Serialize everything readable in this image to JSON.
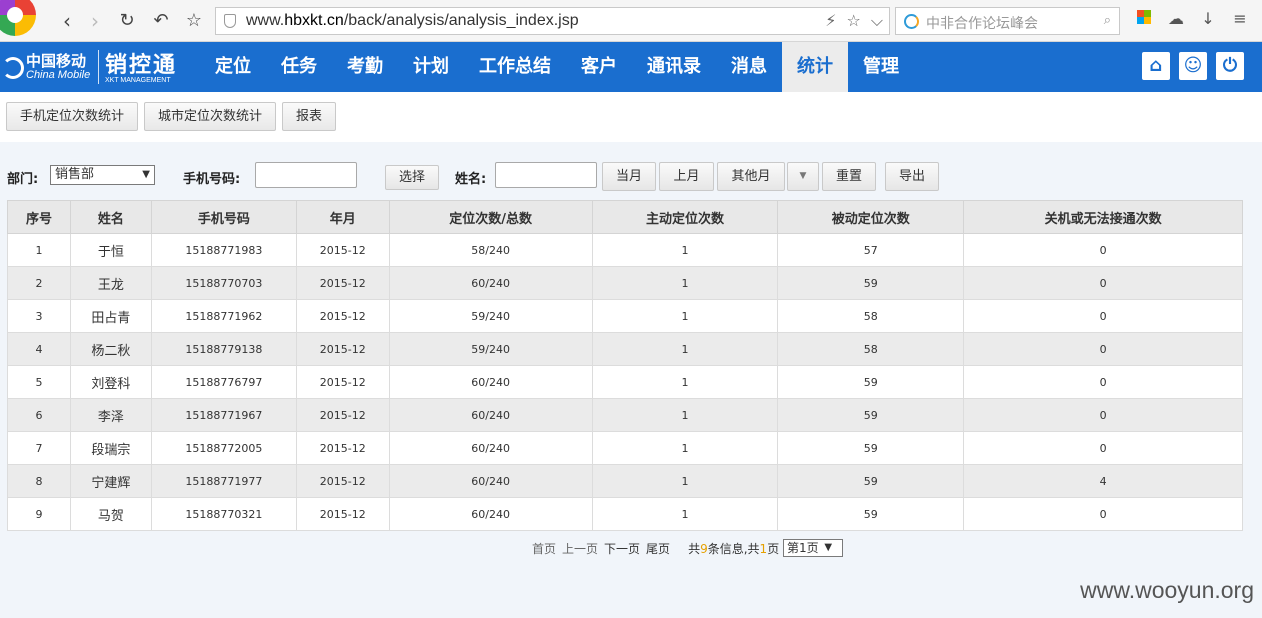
{
  "browser": {
    "url_prefix": "www.",
    "url_host": "hbxkt.cn",
    "url_path": "/back/analysis/analysis_index.jsp",
    "search_placeholder": "中非合作论坛峰会"
  },
  "brand": {
    "carrier_cn": "中国移动",
    "carrier_en": "China Mobile",
    "product_name": "销控通",
    "product_sub": "XKT MANAGEMENT"
  },
  "menu": {
    "items": [
      {
        "label": "定位"
      },
      {
        "label": "任务"
      },
      {
        "label": "考勤"
      },
      {
        "label": "计划"
      },
      {
        "label": "工作总结"
      },
      {
        "label": "客户"
      },
      {
        "label": "通讯录"
      },
      {
        "label": "消息"
      },
      {
        "label": "统计",
        "active": true
      },
      {
        "label": "管理"
      }
    ]
  },
  "subtabs": [
    {
      "label": "手机定位次数统计"
    },
    {
      "label": "城市定位次数统计"
    },
    {
      "label": "报表"
    }
  ],
  "filters": {
    "dept_label": "部门:",
    "dept_value": "销售部",
    "phone_label": "手机号码:",
    "select_button": "选择",
    "name_label": "姓名:",
    "this_month": "当月",
    "last_month": "上月",
    "other_month": "其他月",
    "reset": "重置",
    "export": "导出"
  },
  "table": {
    "columns": [
      "序号",
      "姓名",
      "手机号码",
      "年月",
      "定位次数/总数",
      "主动定位次数",
      "被动定位次数",
      "关机或无法接通次数"
    ],
    "rows": [
      [
        "1",
        "于恒",
        "15188771983",
        "2015-12",
        "58/240",
        "1",
        "57",
        "0"
      ],
      [
        "2",
        "王龙",
        "15188770703",
        "2015-12",
        "60/240",
        "1",
        "59",
        "0"
      ],
      [
        "3",
        "田占青",
        "15188771962",
        "2015-12",
        "59/240",
        "1",
        "58",
        "0"
      ],
      [
        "4",
        "杨二秋",
        "15188779138",
        "2015-12",
        "59/240",
        "1",
        "58",
        "0"
      ],
      [
        "5",
        "刘登科",
        "15188776797",
        "2015-12",
        "60/240",
        "1",
        "59",
        "0"
      ],
      [
        "6",
        "李泽",
        "15188771967",
        "2015-12",
        "60/240",
        "1",
        "59",
        "0"
      ],
      [
        "7",
        "段瑞宗",
        "15188772005",
        "2015-12",
        "60/240",
        "1",
        "59",
        "0"
      ],
      [
        "8",
        "宁建辉",
        "15188771977",
        "2015-12",
        "60/240",
        "1",
        "59",
        "4"
      ],
      [
        "9",
        "马贺",
        "15188770321",
        "2015-12",
        "60/240",
        "1",
        "59",
        "0"
      ]
    ]
  },
  "pager": {
    "first": "首页",
    "prev": "上一页",
    "next": "下一页",
    "last": "尾页",
    "total_prefix": "共",
    "total_count": "9",
    "total_mid": "条信息,共",
    "page_count": "1",
    "total_suffix": "页",
    "page_select": "第1页"
  },
  "watermark": "www.wooyun.org"
}
